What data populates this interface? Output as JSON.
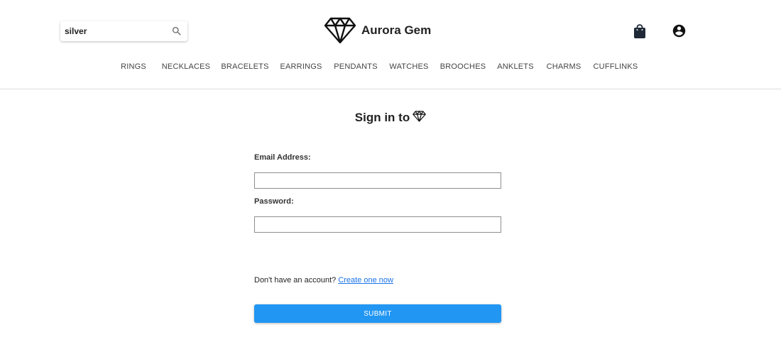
{
  "header": {
    "search": {
      "value": "silver",
      "placeholder": ""
    },
    "brand_name": "Aurora Gem",
    "nav": [
      "RINGS",
      "NECKLACES",
      "BRACELETS",
      "EARRINGS",
      "PENDANTS",
      "WATCHES",
      "BROOCHES",
      "ANKLETS",
      "CHARMS",
      "CUFFLINKS"
    ],
    "icons": {
      "search": "search-icon",
      "logo": "diamond-logo-icon",
      "cart": "shopping-bag-icon",
      "account": "account-circle-icon"
    }
  },
  "signin": {
    "title": "Sign in to",
    "title_icon": "diamond-icon",
    "email_label": "Email Address:",
    "email_value": "",
    "password_label": "Password:",
    "password_value": "",
    "submit_label": "SUBMIT",
    "signup_prompt": "Don't have an account?",
    "signup_link": "Create one now"
  },
  "colors": {
    "accent": "#2196f3",
    "link": "#1a73e8",
    "text": "#222222",
    "divider": "#dcdcdc"
  }
}
